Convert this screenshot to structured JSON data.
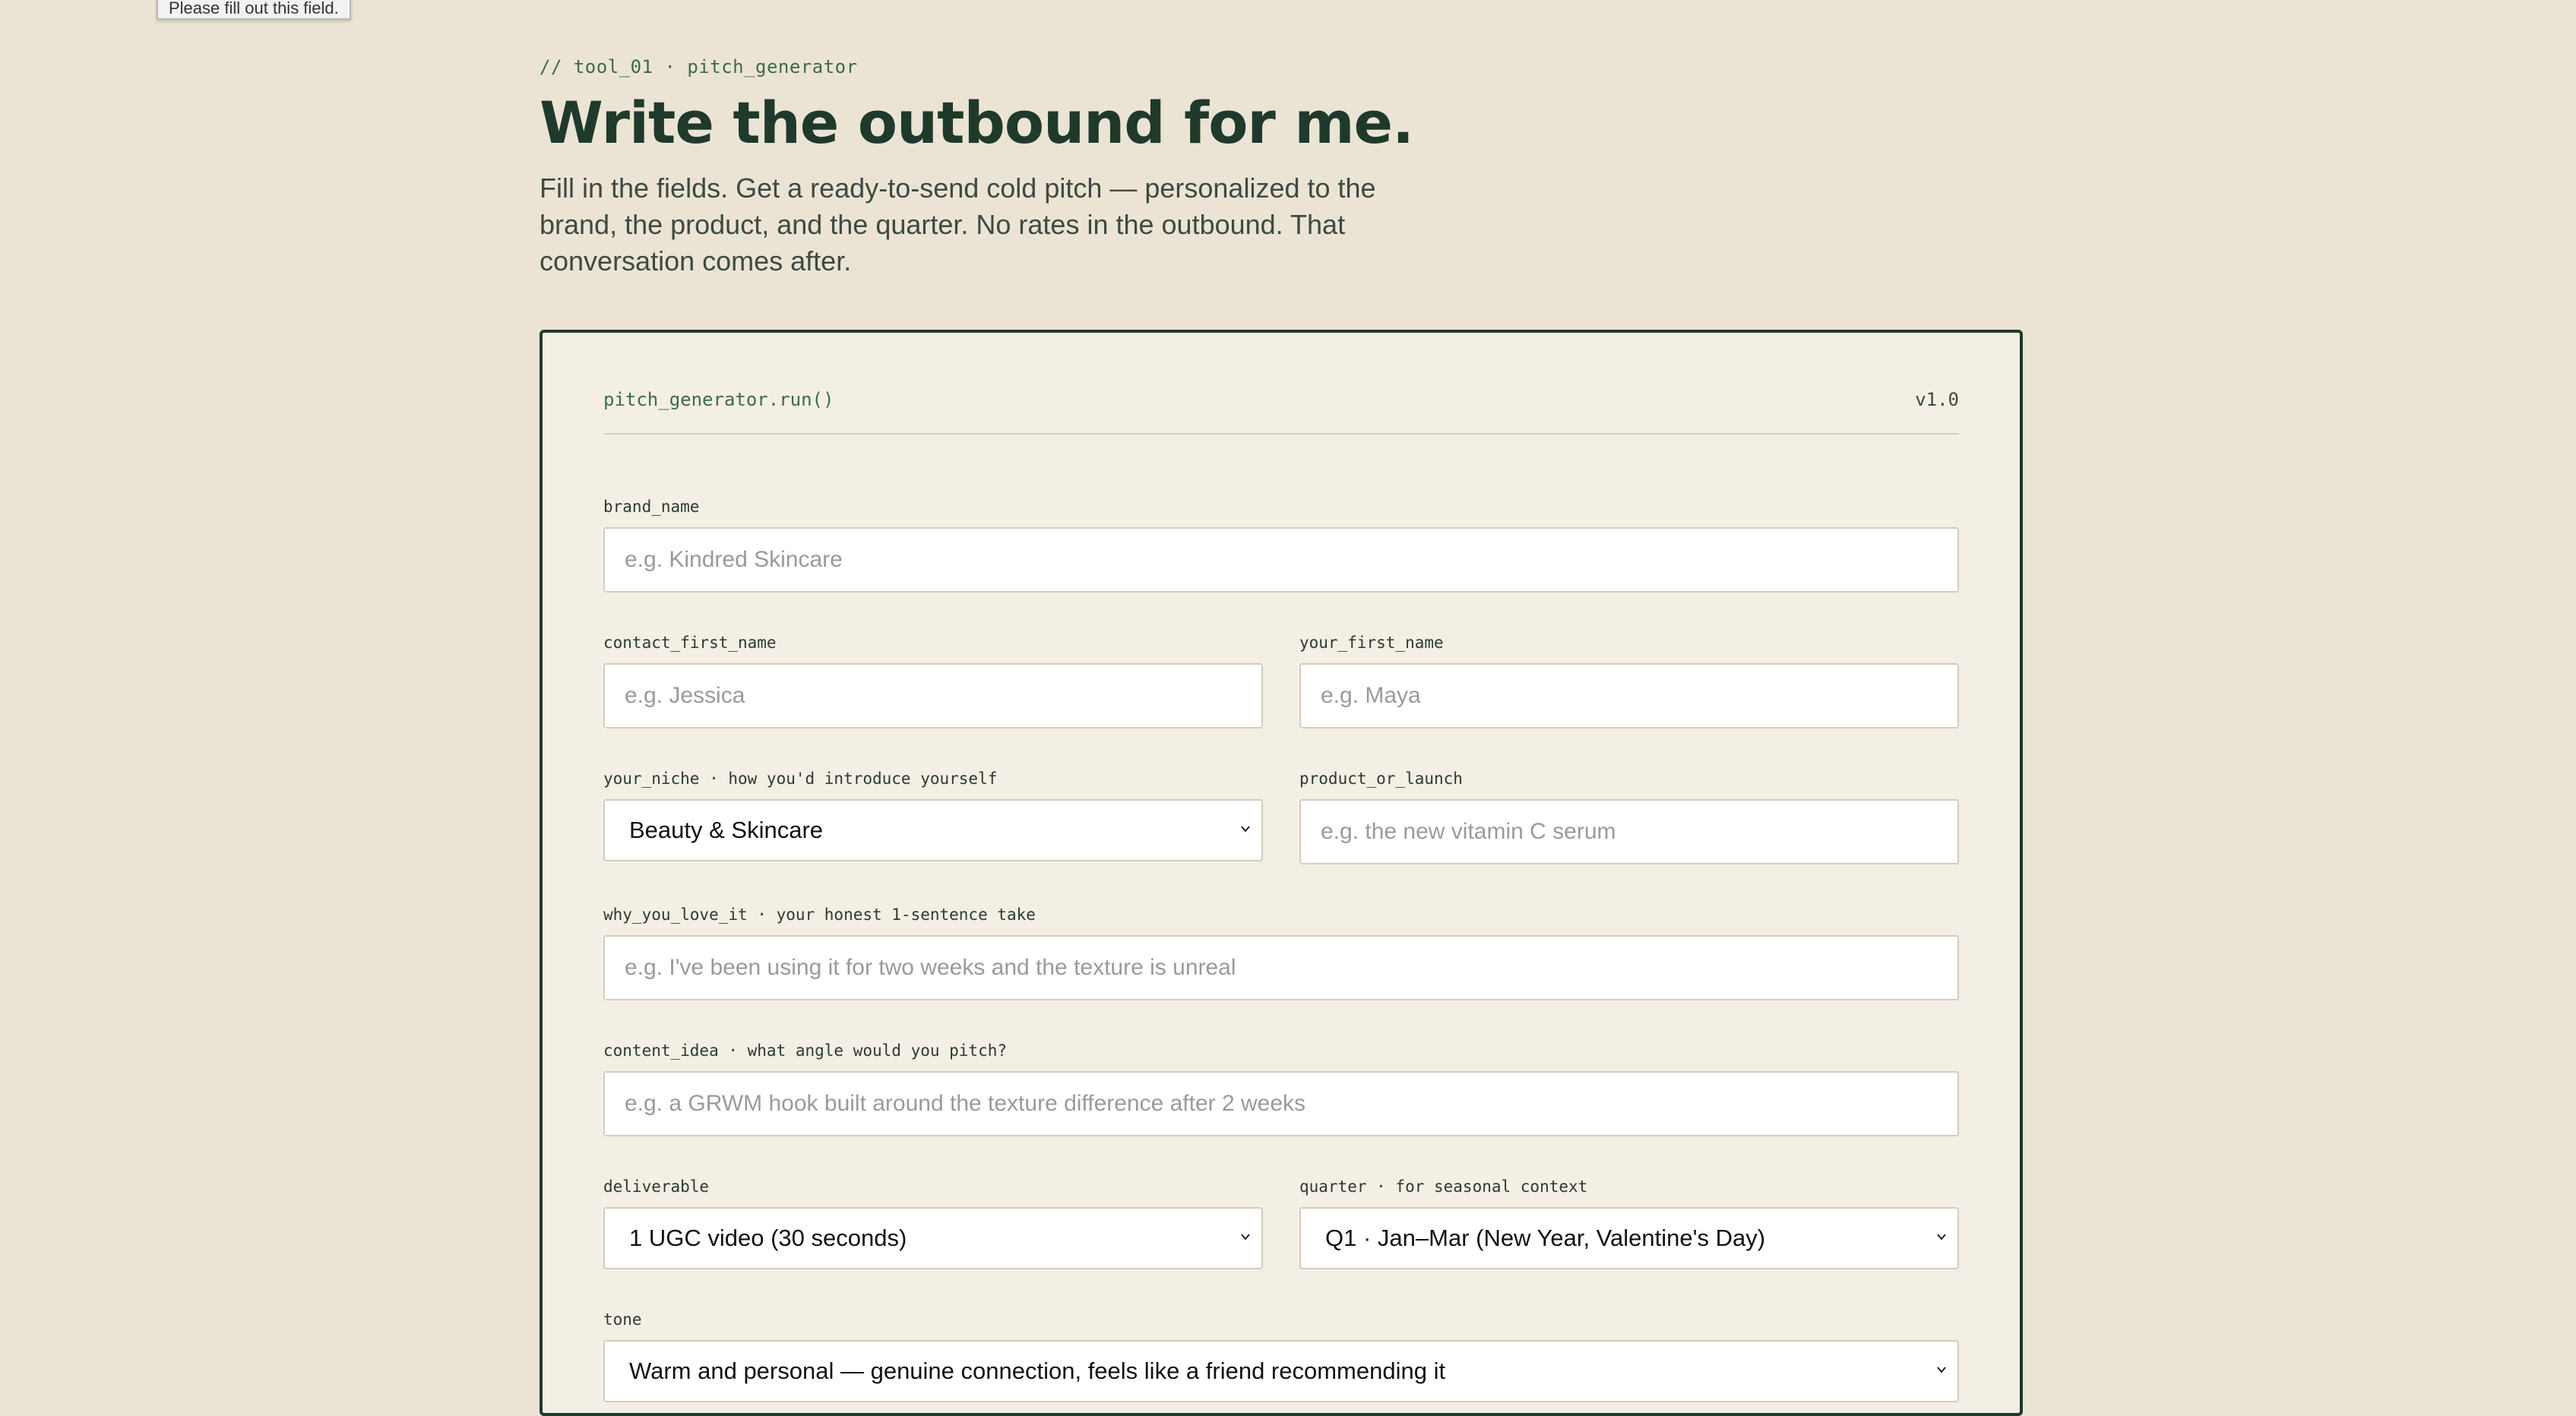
{
  "tooltip": "Please fill out this field.",
  "header": {
    "kicker": "// tool_01 · pitch_generator",
    "title": "Write the outbound for me.",
    "intro": "Fill in the fields. Get a ready-to-send cold pitch — personalized to the brand, the product, and the quarter. No rates in the outbound. That conversation comes after."
  },
  "card": {
    "title": "pitch_generator.run()",
    "version": "v1.0"
  },
  "fields": {
    "brand_name": {
      "label": "brand_name",
      "placeholder": "e.g. Kindred Skincare",
      "value": ""
    },
    "contact_first_name": {
      "label": "contact_first_name",
      "placeholder": "e.g. Jessica",
      "value": ""
    },
    "your_first_name": {
      "label": "your_first_name",
      "placeholder": "e.g. Maya",
      "value": ""
    },
    "your_niche": {
      "label": "your_niche · how you'd introduce yourself",
      "selected": "Beauty & Skincare"
    },
    "product_or_launch": {
      "label": "product_or_launch",
      "placeholder": "e.g. the new vitamin C serum",
      "value": ""
    },
    "why_you_love_it": {
      "label": "why_you_love_it · your honest 1-sentence take",
      "placeholder": "e.g. I've been using it for two weeks and the texture is unreal",
      "value": ""
    },
    "content_idea": {
      "label": "content_idea · what angle would you pitch?",
      "placeholder": "e.g. a GRWM hook built around the texture difference after 2 weeks",
      "value": ""
    },
    "deliverable": {
      "label": "deliverable",
      "selected": "1 UGC video (30 seconds)"
    },
    "quarter": {
      "label": "quarter · for seasonal context",
      "selected": "Q1 · Jan–Mar (New Year, Valentine's Day)"
    },
    "tone": {
      "label": "tone",
      "selected": "Warm and personal — genuine connection, feels like a friend recommending it"
    }
  },
  "icons": {
    "select_arrow": "chevron-down-icon"
  },
  "colors": {
    "background": "#ebe4d5",
    "card": "#f3efe4",
    "ink": "#1f3a2b",
    "accent": "#3d6b4c"
  }
}
